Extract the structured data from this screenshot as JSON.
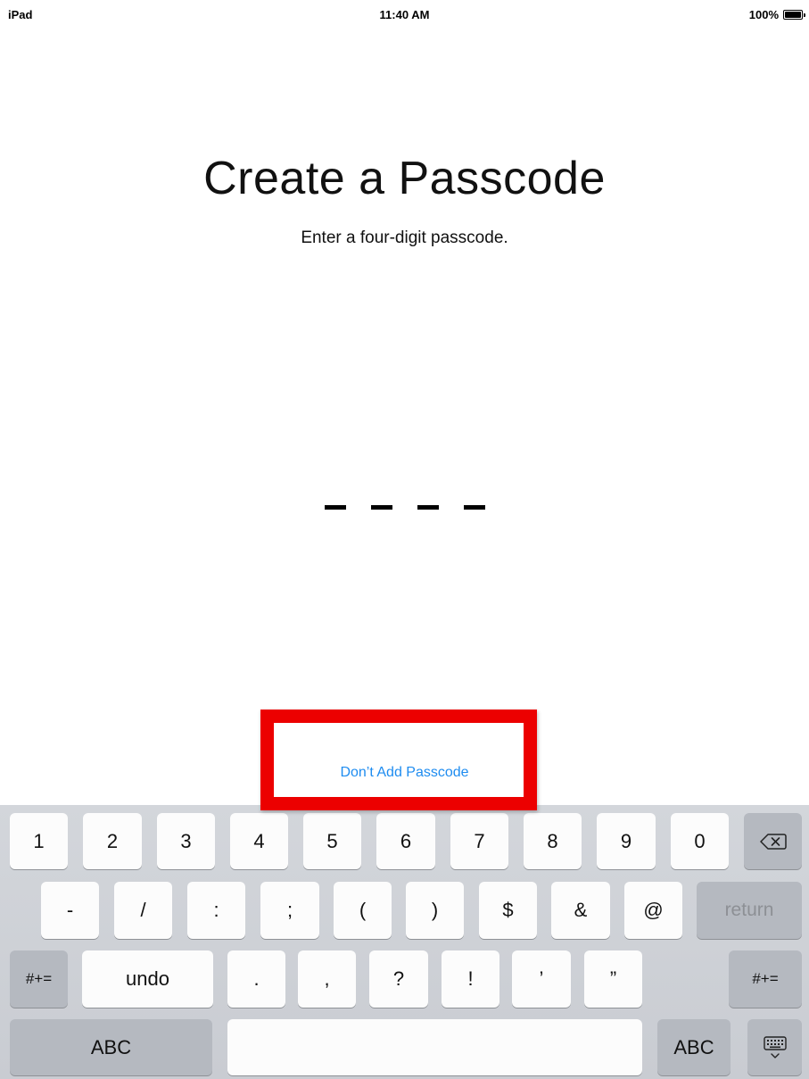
{
  "status_bar": {
    "device": "iPad",
    "time": "11:40 AM",
    "battery": "100%"
  },
  "title": "Create a Passcode",
  "subtitle": "Enter a four-digit passcode.",
  "passcode_length": 4,
  "dont_add_label": "Don’t Add Passcode",
  "colors": {
    "link": "#1e8cf0",
    "highlight": "#ec0000",
    "keyboard_bg": "#d0d3d8"
  },
  "keyboard": {
    "row1": [
      "1",
      "2",
      "3",
      "4",
      "5",
      "6",
      "7",
      "8",
      "9",
      "0"
    ],
    "delete_icon": "delete-backspace-icon",
    "row2": [
      "-",
      "/",
      ":",
      ";",
      "(",
      ")",
      "$",
      "&",
      "@"
    ],
    "return": "return",
    "more_symbols_left": "#+=",
    "undo": "undo",
    "row3": [
      ".",
      ",",
      "?",
      "!",
      "’",
      "”"
    ],
    "more_symbols_right": "#+=",
    "abc_left": "ABC",
    "abc_right": "ABC",
    "dismiss_icon": "keyboard-dismiss-icon"
  }
}
